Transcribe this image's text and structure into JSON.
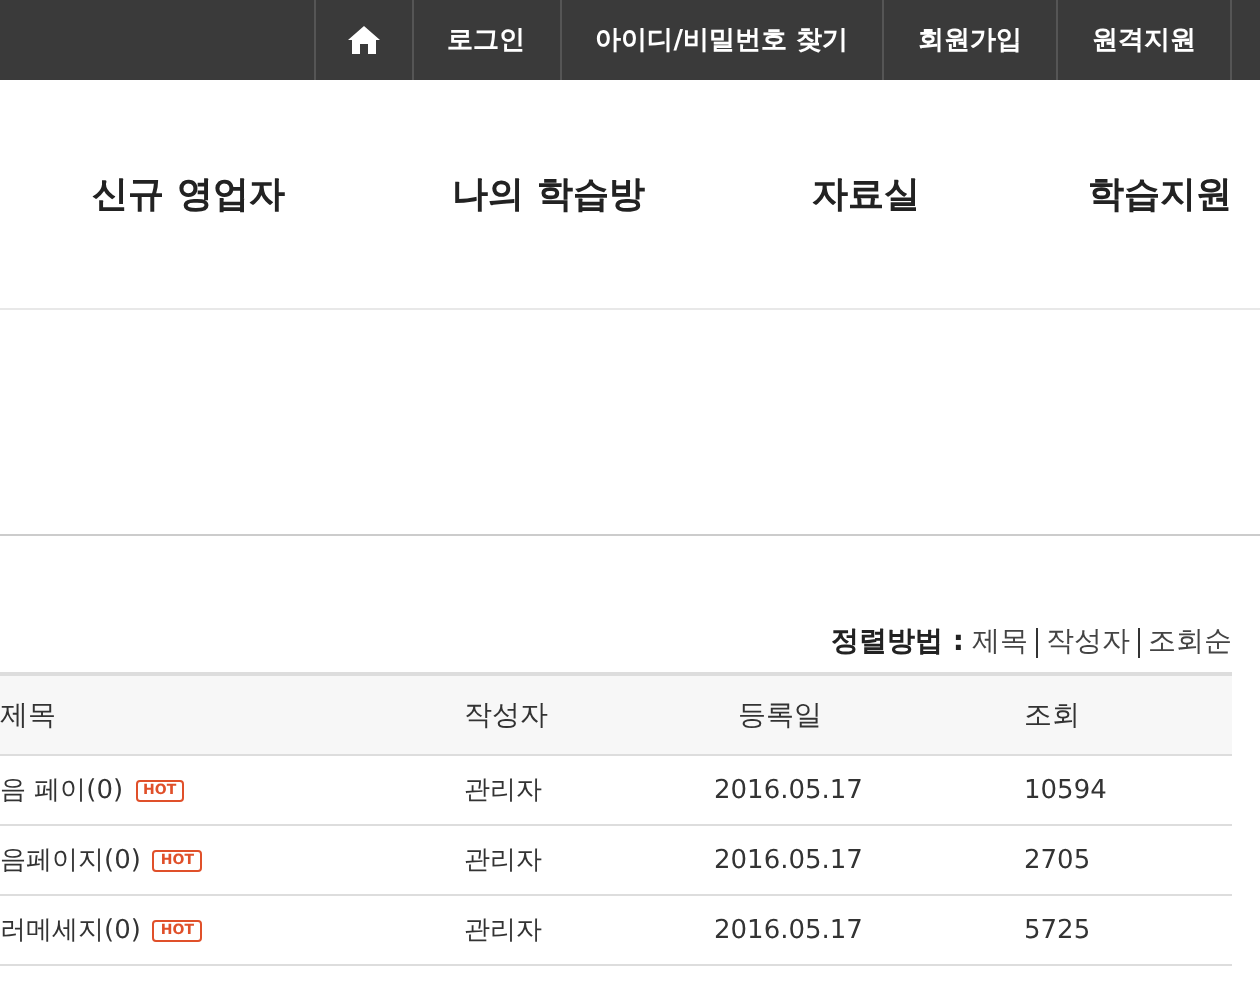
{
  "top_bar": {
    "items": [
      {
        "kind": "home"
      },
      {
        "kind": "text",
        "label": "로그인"
      },
      {
        "kind": "text",
        "label": "아이디/비밀번호 찾기"
      },
      {
        "kind": "text",
        "label": "회원가입"
      },
      {
        "kind": "text",
        "label": "원격지원"
      }
    ]
  },
  "nav": {
    "items": [
      "신규 영업자",
      "나의 학습방",
      "자료실",
      "학습지원"
    ]
  },
  "sort": {
    "label": "정렬방법 :",
    "options": [
      "제목",
      "작성자",
      "조회순"
    ]
  },
  "table": {
    "columns": [
      "제목",
      "작성자",
      "등록일",
      "조회"
    ],
    "rows": [
      {
        "title": "음 페이(0)",
        "badge": "HOT",
        "author": "관리자",
        "date": "2016.05.17",
        "views": "10594"
      },
      {
        "title": "음페이지(0)",
        "badge": "HOT",
        "author": "관리자",
        "date": "2016.05.17",
        "views": "2705"
      },
      {
        "title": "러메세지(0)",
        "badge": "HOT",
        "author": "관리자",
        "date": "2016.05.17",
        "views": "5725"
      }
    ]
  }
}
